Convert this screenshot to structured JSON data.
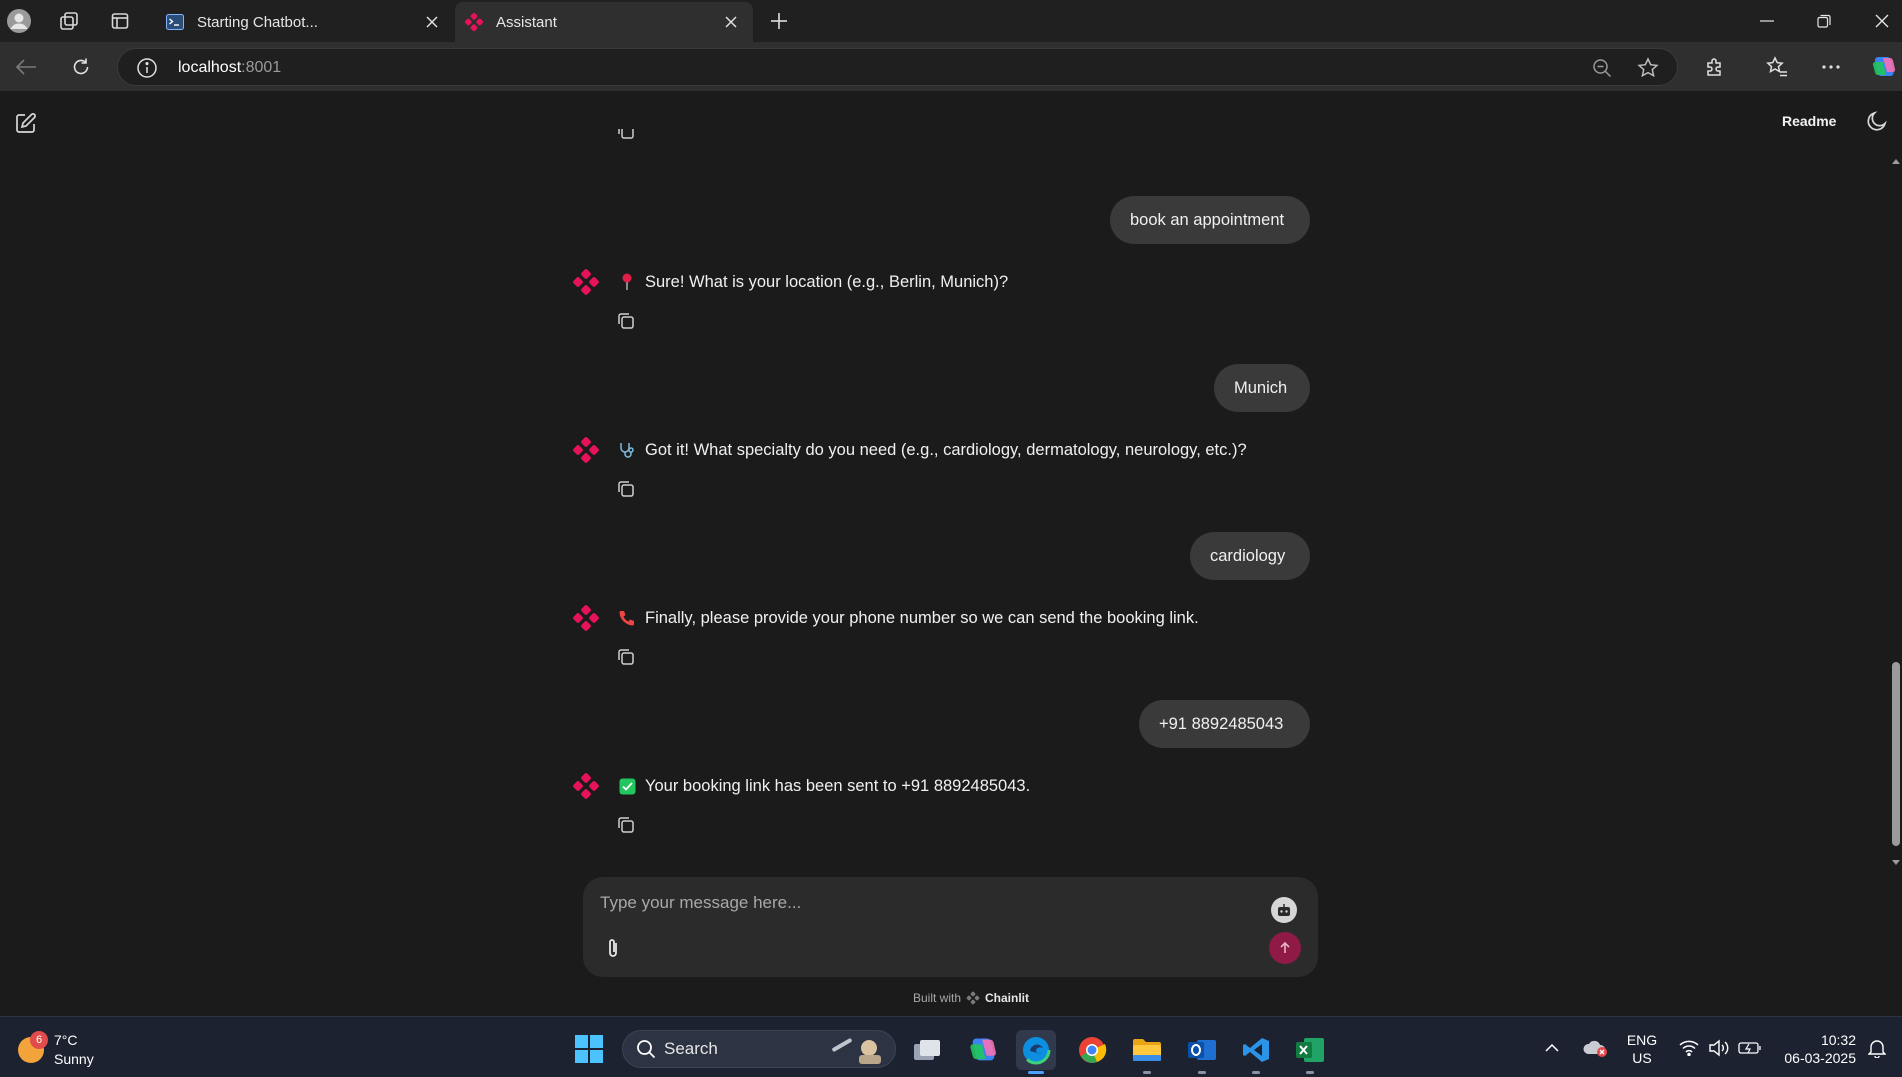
{
  "browser": {
    "tabs": [
      {
        "title": "Starting Chatbot..."
      },
      {
        "title": "Assistant"
      }
    ],
    "address": {
      "host": "localhost",
      "port": ":8001"
    }
  },
  "app": {
    "header": {
      "readme_label": "Readme"
    },
    "messages": [
      {
        "role": "user",
        "text": "book an appointment"
      },
      {
        "role": "assistant",
        "emoji": "pin-icon",
        "text": "Sure! What is your location (e.g., Berlin, Munich)?"
      },
      {
        "role": "user",
        "text": "Munich"
      },
      {
        "role": "assistant",
        "emoji": "stethoscope-icon",
        "text": "Got it! What specialty do you need (e.g., cardiology, dermatology, neurology, etc.)?"
      },
      {
        "role": "user",
        "text": "cardiology"
      },
      {
        "role": "assistant",
        "emoji": "phone-icon",
        "text": "Finally, please provide your phone number so we can send the booking link."
      },
      {
        "role": "user",
        "text": "+91 8892485043"
      },
      {
        "role": "assistant",
        "emoji": "check-icon",
        "text": "Your booking link has been sent to +91 8892485043."
      }
    ],
    "composer": {
      "placeholder": "Type your message here..."
    },
    "footer": {
      "built_with": "Built with",
      "brand": "Chainlit"
    },
    "colors": {
      "accent": "#e8115b",
      "send": "#8e1a45"
    }
  },
  "taskbar": {
    "weather": {
      "badge": "6",
      "temp": "7°C",
      "condition": "Sunny"
    },
    "search_label": "Search",
    "lang": {
      "line1": "ENG",
      "line2": "US"
    },
    "clock": {
      "time": "10:32",
      "date": "06-03-2025"
    }
  }
}
